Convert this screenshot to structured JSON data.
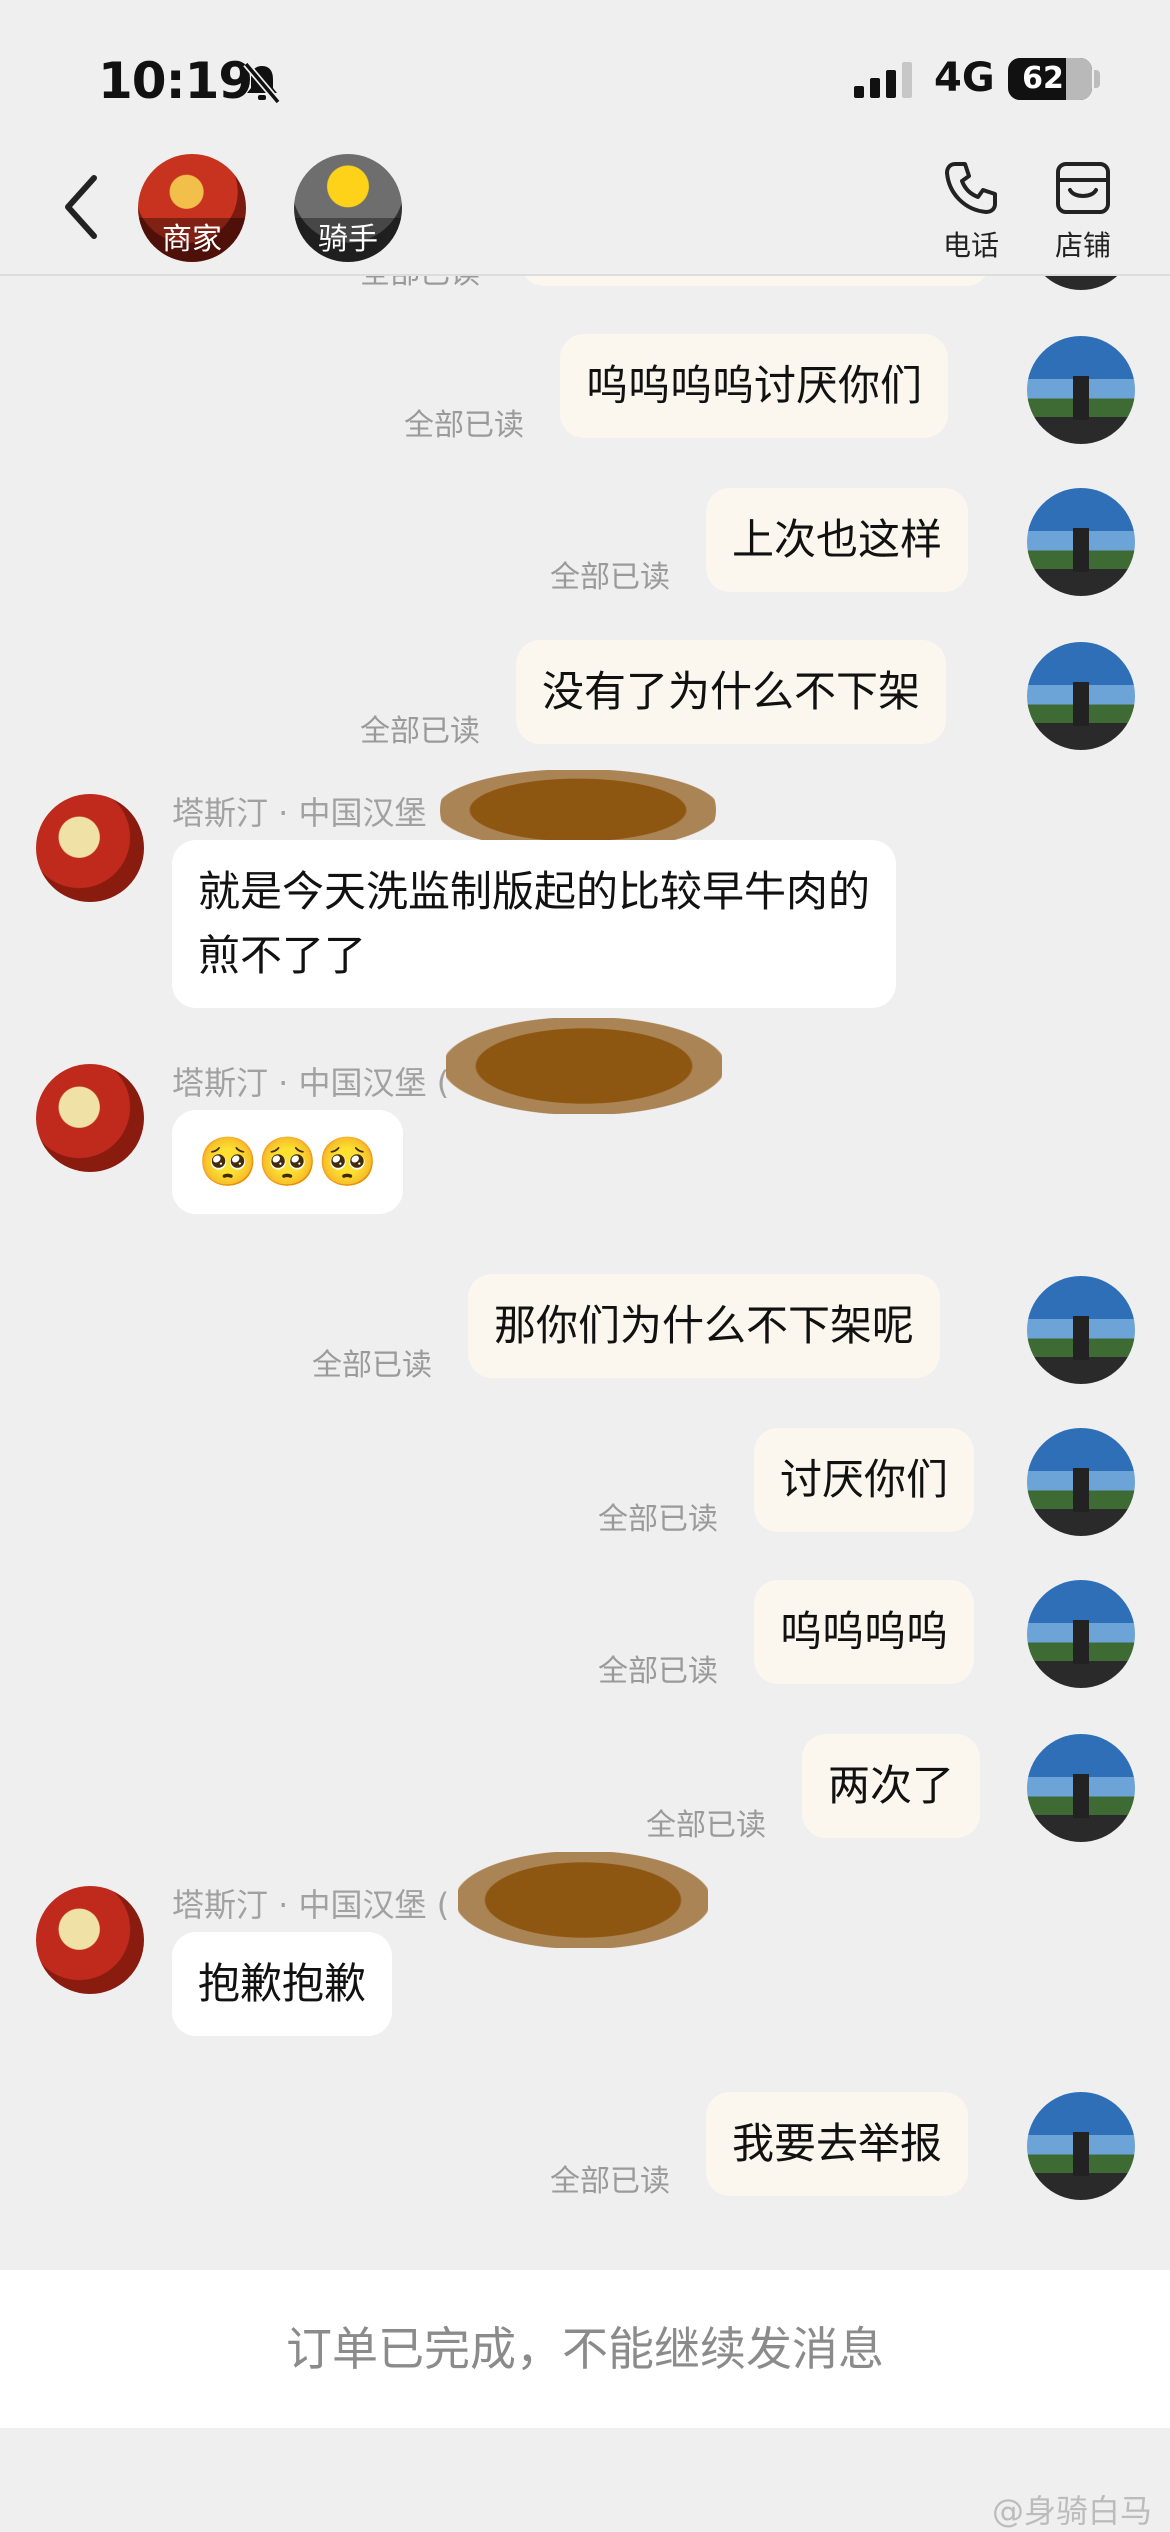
{
  "status_bar": {
    "time": "10:19",
    "network": "4G",
    "battery": "62"
  },
  "header": {
    "merchant_label": "商家",
    "rider_label": "骑手",
    "phone_label": "电话",
    "shop_label": "店铺"
  },
  "messages": {
    "m0_read": "全部已读",
    "m1_text": "呜呜呜呜讨厌你们",
    "m1_read": "全部已读",
    "m2_text": "上次也这样",
    "m2_read": "全部已读",
    "m3_text": "没有了为什么不下架",
    "m3_read": "全部已读",
    "m4_sender": "塔斯汀 · 中国汉堡",
    "m4_line1": "就是今天洗监制版起的比较早牛肉的",
    "m4_line2": "煎不了了",
    "m5_sender": "塔斯汀 · 中国汉堡 (",
    "m5_text": "🥺🥺🥺",
    "m6_text": "那你们为什么不下架呢",
    "m6_read": "全部已读",
    "m7_text": "讨厌你们",
    "m7_read": "全部已读",
    "m8_text": "呜呜呜呜",
    "m8_read": "全部已读",
    "m9_text": "两次了",
    "m9_read": "全部已读",
    "m10_sender": "塔斯汀 · 中国汉堡 (",
    "m10_text": "抱歉抱歉",
    "m11_text": "我要去举报",
    "m11_read": "全部已读"
  },
  "footer": {
    "notice": "订单已完成，不能继续发消息"
  },
  "watermark": "@身骑白马",
  "colors": {
    "outgoing_bubble": "#fbf7ee",
    "incoming_bubble": "#ffffff",
    "background": "#efefef",
    "redaction": "#8d5712"
  },
  "icons": [
    "bell-muted-icon",
    "signal-icon",
    "back-arrow-icon",
    "phone-icon",
    "shop-icon"
  ]
}
